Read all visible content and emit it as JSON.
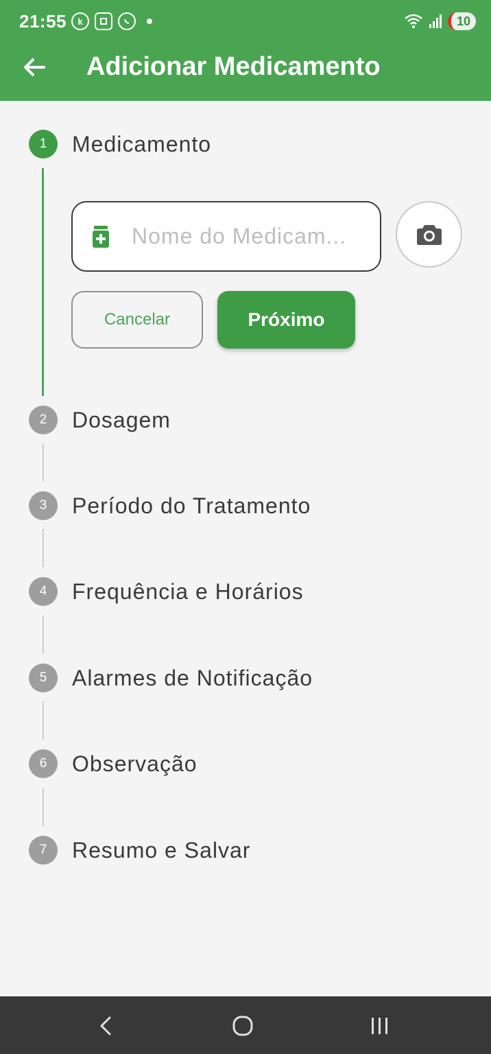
{
  "status_bar": {
    "time": "21:55",
    "battery": "10",
    "left_icons": [
      "k-circle-icon",
      "scan-icon",
      "whatsapp-icon",
      "dot-icon"
    ],
    "right_icons": [
      "wifi-icon",
      "signal-icon",
      "battery-icon"
    ]
  },
  "app_bar": {
    "title": "Adicionar Medicamento",
    "back_icon": "arrow-left-icon",
    "color": "#4aa552"
  },
  "steps": [
    {
      "number": "1",
      "label": "Medicamento",
      "state": "active"
    },
    {
      "number": "2",
      "label": "Dosagem",
      "state": "inactive"
    },
    {
      "number": "3",
      "label": "Período do Tratamento",
      "state": "inactive"
    },
    {
      "number": "4",
      "label": "Frequência e Horários",
      "state": "inactive"
    },
    {
      "number": "5",
      "label": "Alarmes de Notificação",
      "state": "inactive"
    },
    {
      "number": "6",
      "label": "Observação",
      "state": "inactive"
    },
    {
      "number": "7",
      "label": "Resumo e Salvar",
      "state": "inactive"
    }
  ],
  "form": {
    "name_placeholder": "Nome do Medicam...",
    "name_value": "",
    "input_icon": "medication-icon",
    "camera_icon": "camera-icon",
    "cancel_label": "Cancelar",
    "next_label": "Próximo"
  },
  "nav_bar": {
    "icons": [
      "nav-back-icon",
      "nav-home-icon",
      "nav-recents-icon"
    ]
  }
}
